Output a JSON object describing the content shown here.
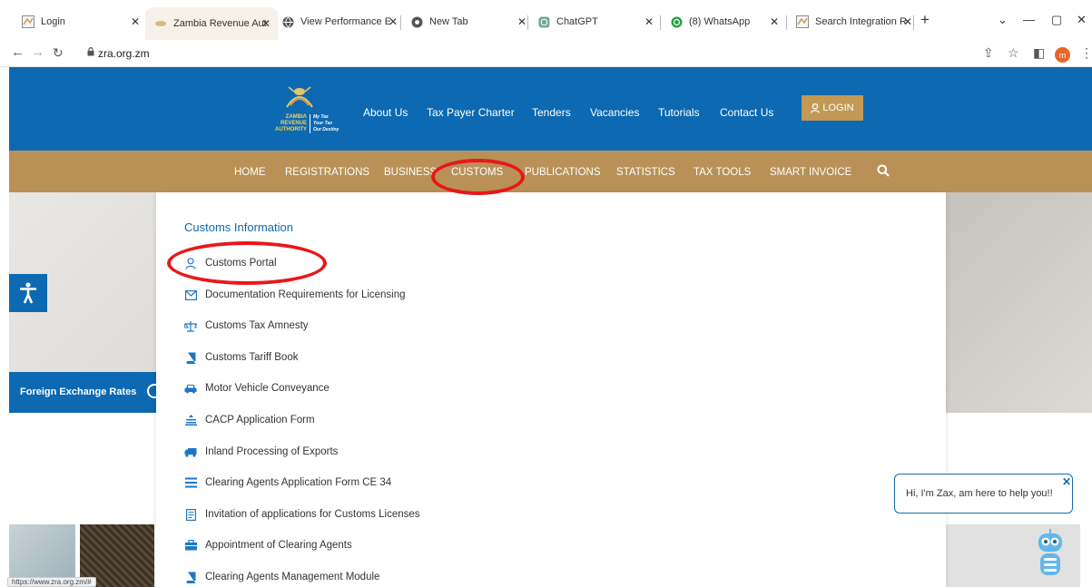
{
  "browser": {
    "tabs": [
      {
        "label": "Login",
        "favicon": "zra-favicon",
        "active": false
      },
      {
        "label": "Zambia Revenue Aut",
        "favicon": "zra-favicon",
        "active": true
      },
      {
        "label": "View Performance E",
        "favicon": "globe-icon",
        "active": false
      },
      {
        "label": "New Tab",
        "favicon": "chrome-icon",
        "active": false
      },
      {
        "label": "ChatGPT",
        "favicon": "chatgpt-icon",
        "active": false
      },
      {
        "label": "(8) WhatsApp",
        "favicon": "whatsapp-icon",
        "active": false
      },
      {
        "label": "Search Integration R",
        "favicon": "zra-favicon",
        "active": false
      }
    ],
    "url": "zra.org.zm",
    "status_url": "https://www.zra.org.zm/#",
    "profile_initial": "m"
  },
  "site": {
    "logo": {
      "name_lines": [
        "ZAMBIA",
        "REVENUE",
        "AUTHORITY"
      ],
      "slogan_lines": [
        "My Tax",
        "Your Tax",
        "Our Destiny"
      ]
    },
    "top_links": [
      "About Us",
      "Tax Payer Charter",
      "Tenders",
      "Vacancies",
      "Tutorials",
      "Contact Us"
    ],
    "login_label": "LOGIN",
    "nav": [
      "HOME",
      "REGISTRATIONS",
      "BUSINESS",
      "CUSTOMS",
      "PUBLICATIONS",
      "STATISTICS",
      "TAX TOOLS",
      "SMART INVOICE"
    ],
    "fx_label": "Foreign Exchange Rates"
  },
  "dropdown": {
    "title": "Customs Information",
    "items": [
      {
        "label": "Customs Portal",
        "icon": "user-icon"
      },
      {
        "label": "Documentation Requirements for Licensing",
        "icon": "envelope-icon"
      },
      {
        "label": "Customs Tax Amnesty",
        "icon": "scale-icon"
      },
      {
        "label": "Customs Tariff Book",
        "icon": "book-icon"
      },
      {
        "label": "Motor Vehicle Conveyance",
        "icon": "car-icon"
      },
      {
        "label": "CACP Application Form",
        "icon": "form-icon"
      },
      {
        "label": "Inland Processing of Exports",
        "icon": "truck-icon"
      },
      {
        "label": "Clearing Agents Application Form CE 34",
        "icon": "list-icon"
      },
      {
        "label": "Invitation of applications for Customs Licenses",
        "icon": "document-icon"
      },
      {
        "label": "Appointment of Clearing Agents",
        "icon": "briefcase-icon"
      },
      {
        "label": "Clearing Agents Management Module",
        "icon": "book-icon"
      }
    ]
  },
  "chat": {
    "message": "Hi, I'm Zax, am here to help you!!"
  },
  "colors": {
    "brand_blue": "#0d69b1",
    "brand_gold": "#b99156",
    "login_gold": "#c29a55",
    "annotation_red": "#e8171b"
  }
}
